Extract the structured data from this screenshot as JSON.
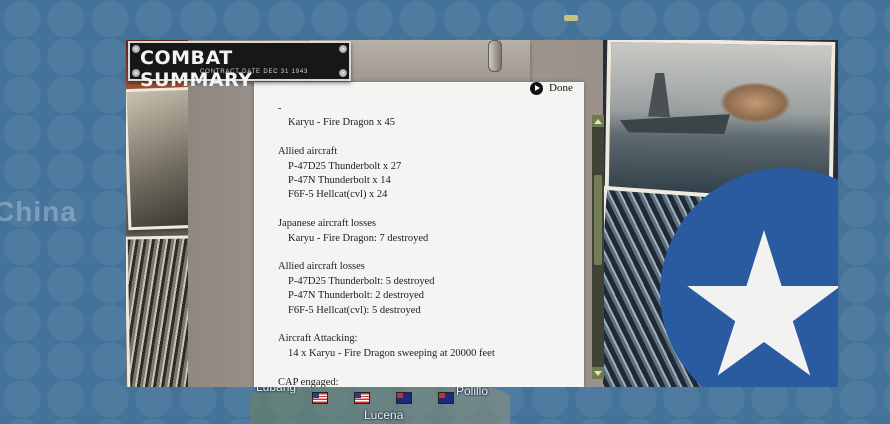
{
  "map": {
    "region_label": "China",
    "places": [
      "Lubang",
      "Lucena",
      "Polillo"
    ]
  },
  "dialog": {
    "title": "COMBAT SUMMARY",
    "subtitle": "CONTRACT DATE DEC 31 1943",
    "done_label": "Done",
    "report": {
      "top_dash": "-",
      "top_line": "Karyu - Fire Dragon x 45",
      "allied_aircraft_header": "Allied aircraft",
      "allied_aircraft": [
        "P-47D25 Thunderbolt x 27",
        "P-47N Thunderbolt x 14",
        "F6F-5 Hellcat(cvl) x 24"
      ],
      "japanese_losses_header": "Japanese aircraft losses",
      "japanese_losses": [
        "Karyu - Fire Dragon: 7 destroyed"
      ],
      "allied_losses_header": "Allied aircraft losses",
      "allied_losses": [
        "P-47D25 Thunderbolt: 5 destroyed",
        "P-47N Thunderbolt: 2 destroyed",
        "F6F-5 Hellcat(cvl): 5 destroyed"
      ],
      "attacking_header": "Aircraft Attacking:",
      "attacking": [
        "14 x Karyu - Fire Dragon sweeping at 20000 feet"
      ],
      "cap_header": "CAP engaged:"
    }
  },
  "colors": {
    "map_sea": "#44739a",
    "roundel_blue": "#2a5aa0",
    "scrollbar": "#6f7a4f"
  }
}
